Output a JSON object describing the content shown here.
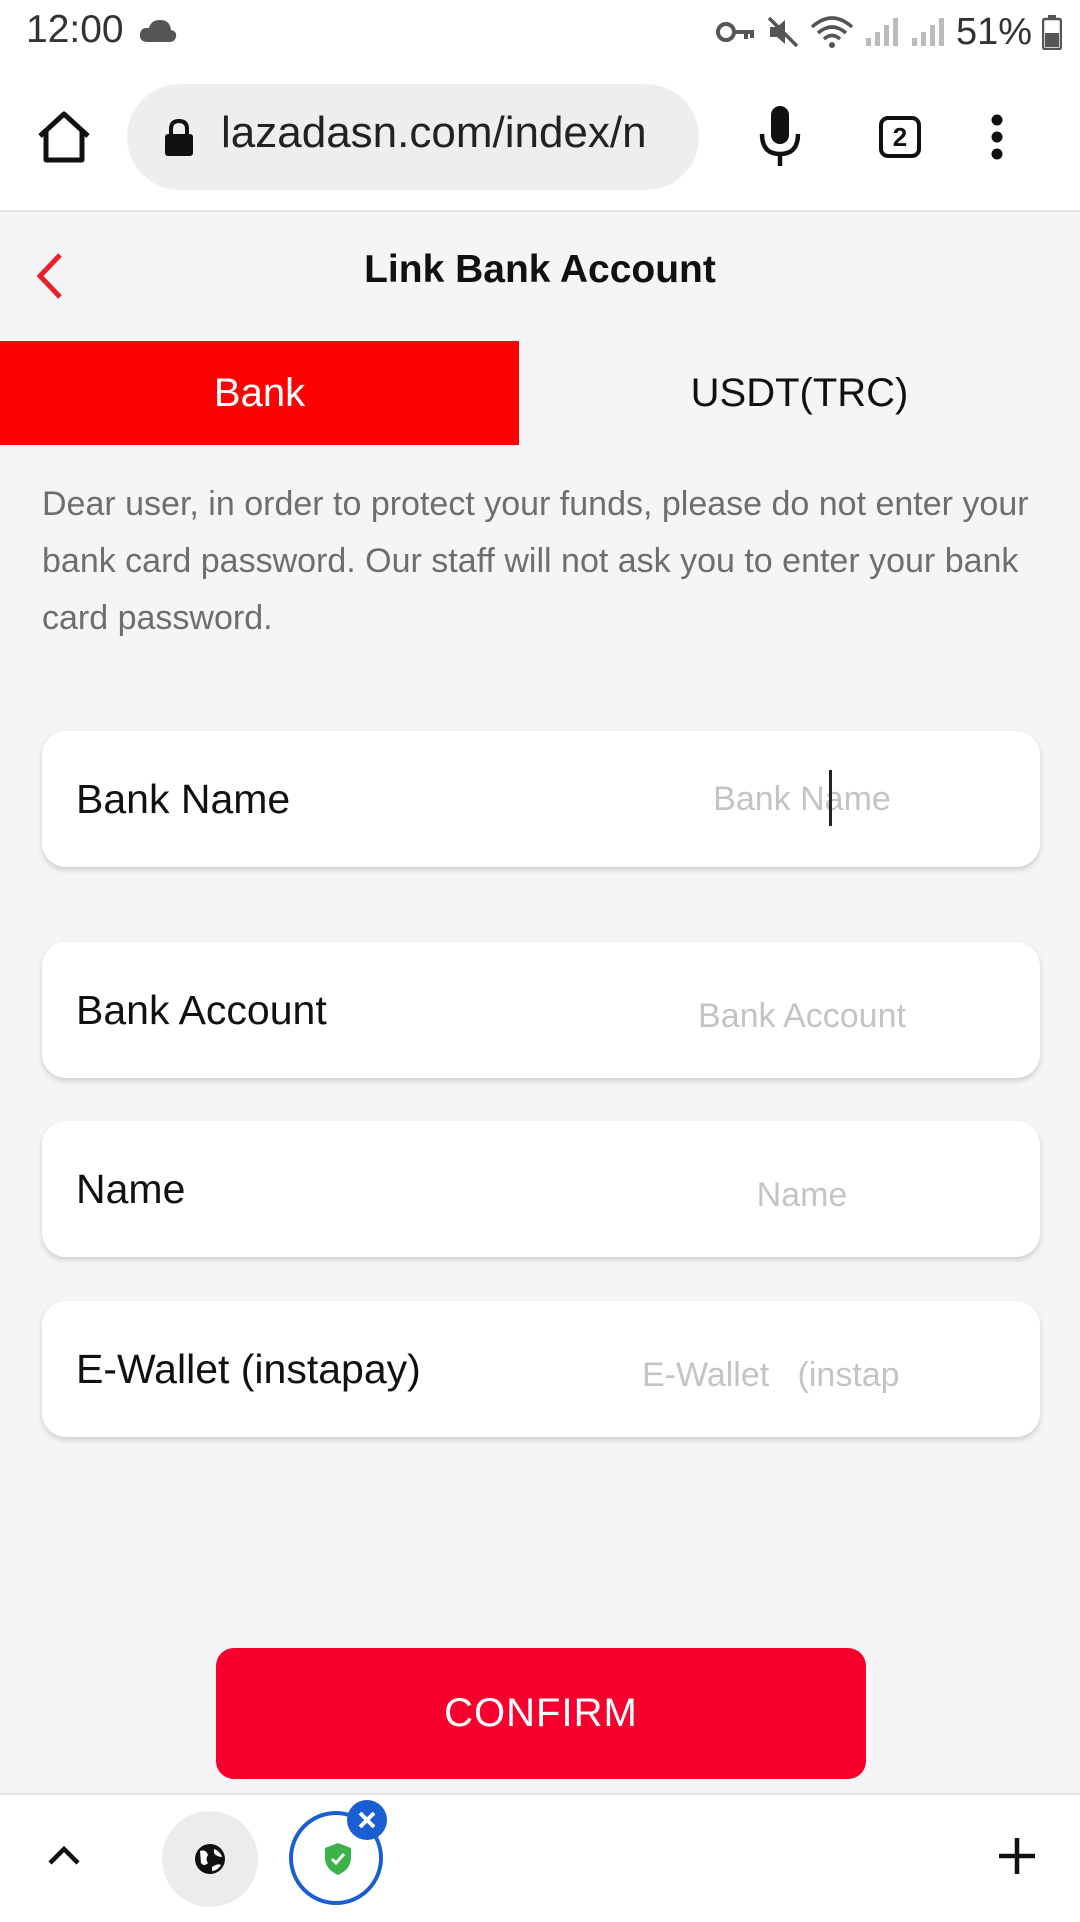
{
  "status_bar": {
    "time": "12:00",
    "battery": "51%"
  },
  "browser": {
    "url": "lazadasn.com/index/n",
    "tab_count": "2"
  },
  "page": {
    "title": "Link Bank Account"
  },
  "tabs": [
    {
      "label": "Bank",
      "active": true
    },
    {
      "label": "USDT(TRC)",
      "active": false
    }
  ],
  "notice": "Dear user, in order to protect your funds, please do not enter your bank card password. Our staff will not ask you to enter your bank card password.",
  "form": {
    "fields": [
      {
        "label": "Bank Name",
        "placeholder": "Bank Name",
        "value": ""
      },
      {
        "label": "Bank Account",
        "placeholder": "Bank Account",
        "value": ""
      },
      {
        "label": "Name",
        "placeholder": "Name",
        "value": ""
      },
      {
        "label": "E-Wallet (instapay)",
        "placeholder": "E-Wallet   (instap",
        "value": ""
      }
    ],
    "confirm_label": "CONFIRM"
  },
  "colors": {
    "accent": "#fb0303",
    "confirm": "#f8002e",
    "shield_blue": "#1a5fd1"
  },
  "icons": [
    "cloud-icon",
    "key-icon",
    "mute-icon",
    "wifi-icon",
    "signal-icon",
    "battery-icon",
    "home-icon",
    "lock-icon",
    "mic-icon",
    "tabs-icon",
    "more-icon",
    "chevron-left-icon",
    "chevron-up-icon",
    "globe-icon",
    "shield-icon",
    "close-icon",
    "plus-icon"
  ]
}
